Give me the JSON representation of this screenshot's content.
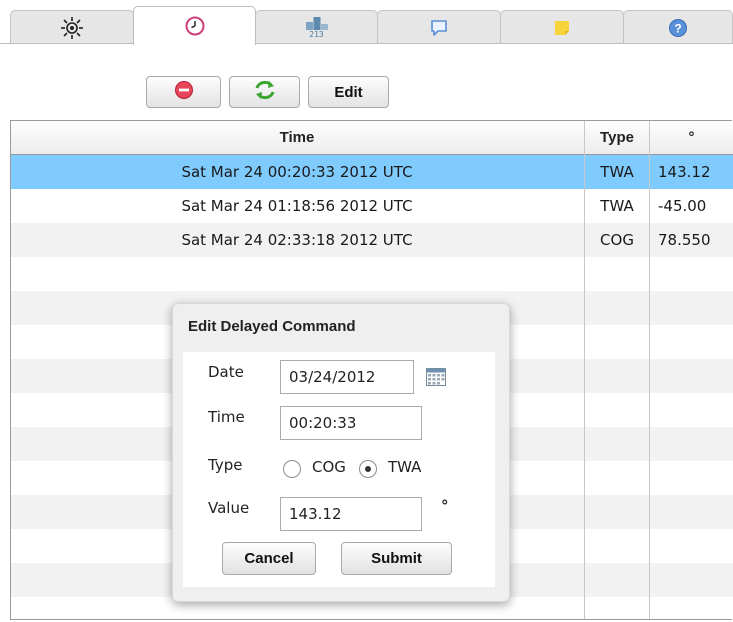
{
  "tabs": [
    {
      "id": "compass",
      "icon": "sun-compass-icon"
    },
    {
      "id": "delayed",
      "icon": "clock-icon",
      "active": true
    },
    {
      "id": "ranking",
      "icon": "ranking-icon",
      "text": "213"
    },
    {
      "id": "chat",
      "icon": "chat-bubble-icon"
    },
    {
      "id": "notes",
      "icon": "sticky-note-icon"
    },
    {
      "id": "help",
      "icon": "help-icon"
    }
  ],
  "toolbar": {
    "delete_icon": "minus-circle-icon",
    "refresh_icon": "refresh-icon",
    "edit_label": "Edit"
  },
  "table": {
    "columns": [
      "Time",
      "Type",
      "°"
    ],
    "rows": [
      {
        "time": "Sat Mar 24 00:20:33 2012 UTC",
        "type": "TWA",
        "value": "143.12",
        "selected": true
      },
      {
        "time": "Sat Mar 24 01:18:56 2012 UTC",
        "type": "TWA",
        "value": "-45.00"
      },
      {
        "time": "Sat Mar 24 02:33:18 2012 UTC",
        "type": "COG",
        "value": "78.550"
      }
    ]
  },
  "dialog": {
    "title": "Edit Delayed Command",
    "date_label": "Date",
    "date_value": "03/24/2012",
    "time_label": "Time",
    "time_value": "00:20:33",
    "type_label": "Type",
    "options": [
      "COG",
      "TWA"
    ],
    "selected_option": "TWA",
    "value_label": "Value",
    "value_value": "143.12",
    "unit": "°",
    "cancel_label": "Cancel",
    "submit_label": "Submit"
  },
  "colors": {
    "selected_row": "#7fcbfd",
    "alt_row": "#f2f2f2",
    "tab_inactive": "#e6e6e6"
  }
}
